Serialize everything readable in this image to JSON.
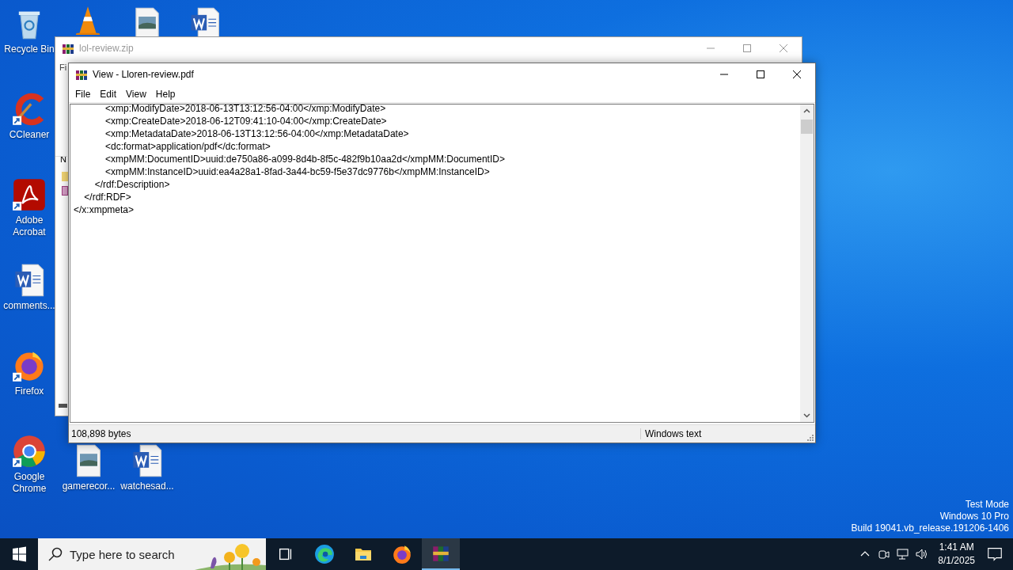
{
  "desktop_icons": [
    {
      "kind": "recycle-bin",
      "label": "Recycle Bin",
      "shortcut": false
    },
    {
      "kind": "vlc",
      "shortcut": false
    },
    {
      "kind": "image-file",
      "shortcut": false
    },
    {
      "kind": "word-file",
      "shortcut": false
    },
    {
      "kind": "ccleaner",
      "label": "CCleaner",
      "shortcut": true
    },
    {
      "kind": "acrobat",
      "label": "Adobe Acrobat",
      "shortcut": true
    },
    {
      "kind": "word-file",
      "label": "comments...",
      "shortcut": false
    },
    {
      "kind": "firefox",
      "label": "Firefox",
      "shortcut": true
    },
    {
      "kind": "chrome",
      "label": "Google Chrome",
      "shortcut": true
    },
    {
      "kind": "image-file",
      "label": "gamerecor...",
      "shortcut": false
    },
    {
      "kind": "word-file",
      "label": "watchesad...",
      "shortcut": false
    }
  ],
  "back_window": {
    "title": "lol-review.zip",
    "menu_partial": "Fi",
    "column_partial": "N"
  },
  "viewer": {
    "title": "View - Lloren-review.pdf",
    "menu": [
      "File",
      "Edit",
      "View",
      "Help"
    ],
    "lines": [
      "            <xmp:ModifyDate>2018-06-13T13:12:56-04:00</xmp:ModifyDate>",
      "            <xmp:CreateDate>2018-06-12T09:41:10-04:00</xmp:CreateDate>",
      "            <xmp:MetadataDate>2018-06-13T13:12:56-04:00</xmp:MetadataDate>",
      "            <dc:format>application/pdf</dc:format>",
      "            <xmpMM:DocumentID>uuid:de750a86-a099-8d4b-8f5c-482f9b10aa2d</xmpMM:DocumentID>",
      "            <xmpMM:InstanceID>uuid:ea4a28a1-8fad-3a44-bc59-f5e37dc9776b</xmpMM:InstanceID>",
      "        </rdf:Description>",
      "    </rdf:RDF>",
      "</x:xmpmeta>"
    ],
    "status": [
      "108,898 bytes",
      "Windows text"
    ]
  },
  "system_info": [
    "Test Mode",
    "Windows 10 Pro",
    "Build 19041.vb_release.191206-1406"
  ],
  "taskbar": {
    "search_placeholder": "Type here to search",
    "apps": [
      {
        "kind": "task-view",
        "selected": false
      },
      {
        "kind": "edge",
        "selected": false
      },
      {
        "kind": "explorer",
        "selected": false
      },
      {
        "kind": "firefox",
        "selected": false
      },
      {
        "kind": "winrar",
        "selected": true
      }
    ],
    "time": "1:41 AM",
    "date": "8/1/2025"
  }
}
